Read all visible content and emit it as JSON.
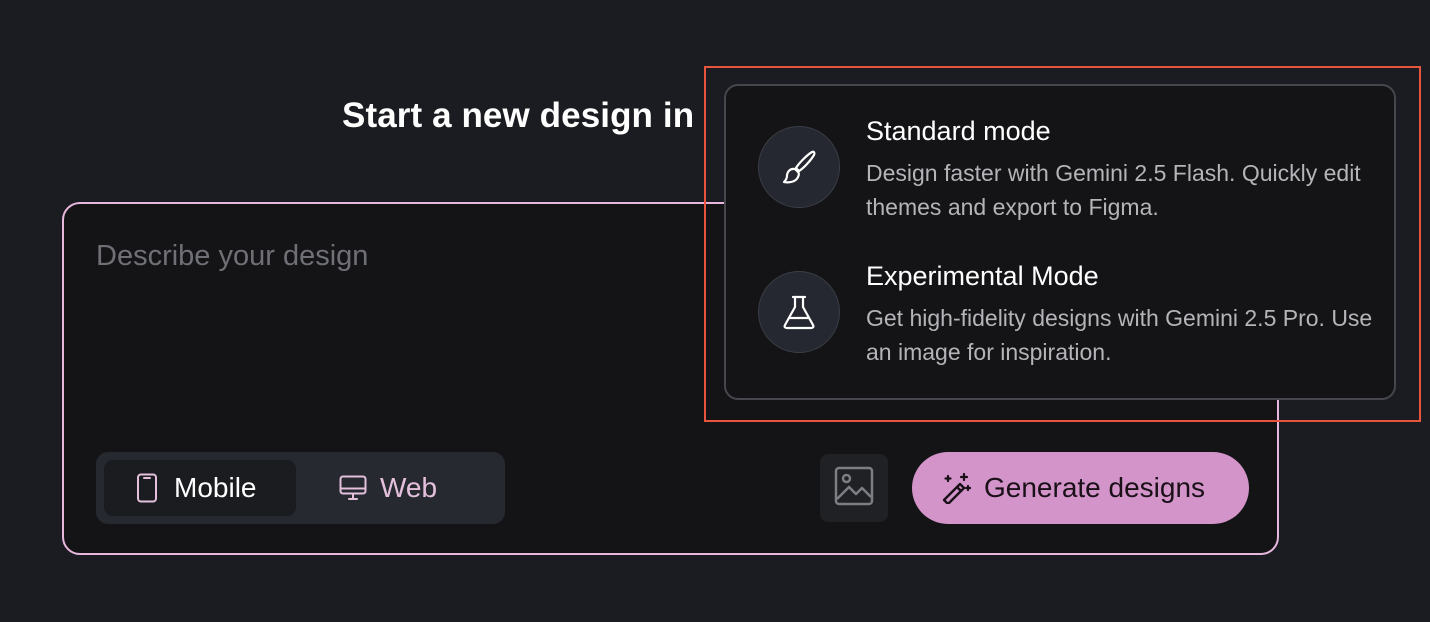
{
  "headline": "Start a new design in",
  "composer": {
    "placeholder": "Describe your design",
    "device_options": [
      {
        "label": "Mobile",
        "icon": "phone-icon",
        "selected": true
      },
      {
        "label": "Web",
        "icon": "monitor-icon",
        "selected": false
      }
    ],
    "image_button_icon": "image-icon",
    "generate_label": "Generate designs",
    "generate_icon": "magic-wand-icon"
  },
  "mode_menu": {
    "items": [
      {
        "title": "Standard mode",
        "description": "Design faster with Gemini 2.5 Flash. Quickly edit themes and export to Figma.",
        "icon": "paintbrush-icon"
      },
      {
        "title": "Experimental Mode",
        "description": "Get high-fidelity designs with Gemini 2.5 Pro. Use an image for inspiration.",
        "icon": "flask-icon"
      }
    ]
  },
  "colors": {
    "background": "#1b1c21",
    "accent_pink": "#d394c9",
    "border_pink": "#e8b7dd",
    "highlight_red": "#e8553f"
  }
}
